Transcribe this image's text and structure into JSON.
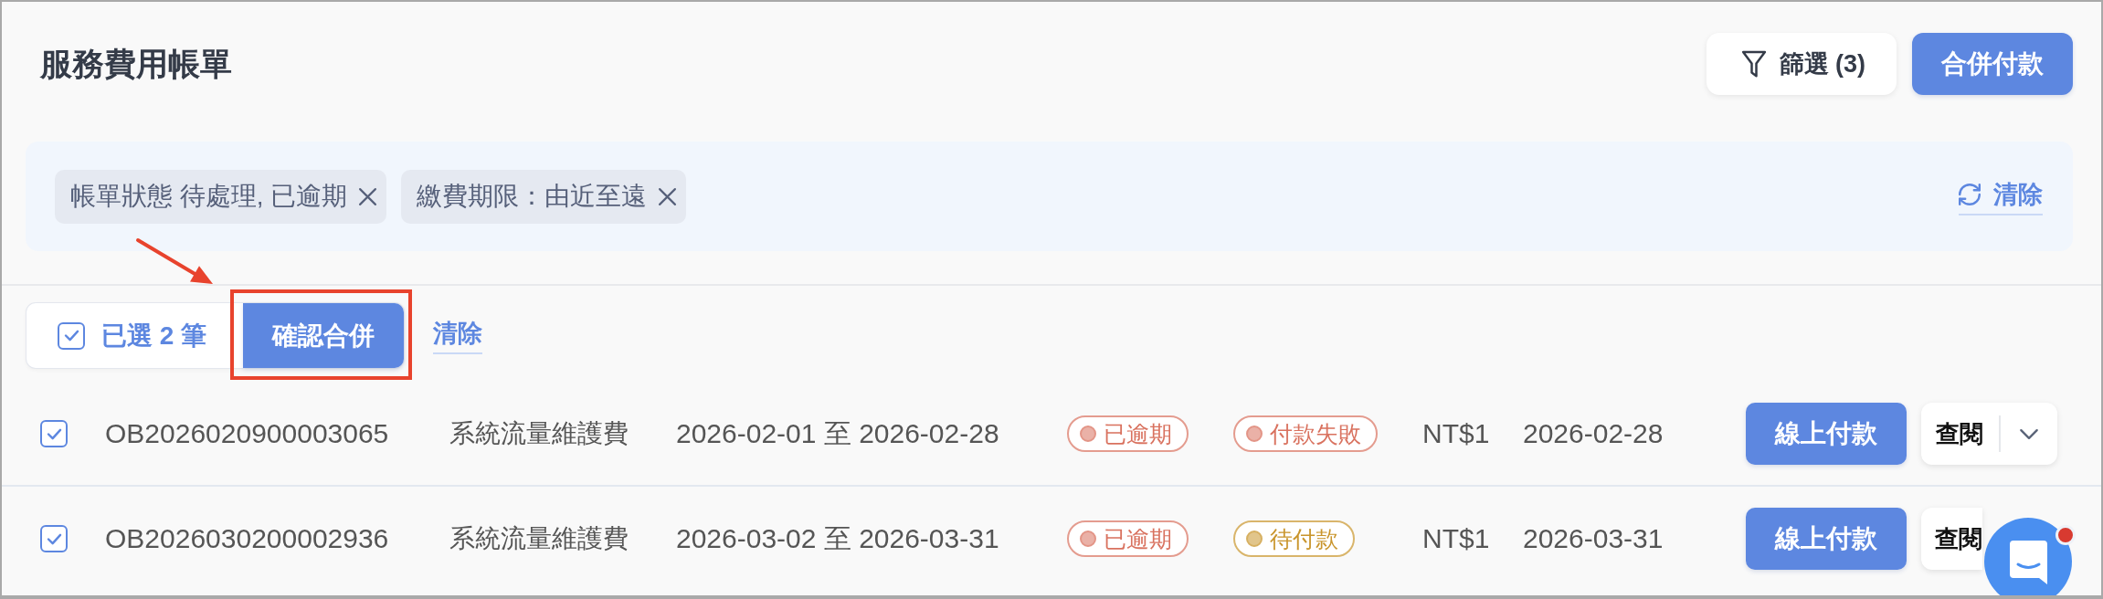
{
  "page": {
    "title": "服務費用帳單"
  },
  "toolbar": {
    "filter_button": "篩選 (3)",
    "merge_button": "合併付款"
  },
  "filter_panel": {
    "chips": [
      {
        "label": "帳單狀態 待處理, 已逾期"
      },
      {
        "label": "繳費期限：由近至遠"
      }
    ],
    "clear_link": "清除"
  },
  "selection_bar": {
    "checked": true,
    "count": "已選 2 筆",
    "confirm_button": {
      "label": "確認合併",
      "highlighted": true
    },
    "clear_link": "清除"
  },
  "rows": [
    {
      "selected": true,
      "number": "OB2026020900003065",
      "item": "系統流量維護費",
      "period": "2026-02-01 至 2026-02-28",
      "badges": [
        {
          "label": "已逾期",
          "color": "#d9725f"
        },
        {
          "label": "付款失敗",
          "color": "#d9725f"
        }
      ],
      "amount": "NT$1",
      "date": "2026-02-28",
      "pay_button": "線上付款",
      "view_button": "查閱"
    },
    {
      "selected": true,
      "number": "OB2026030200002936",
      "item": "系統流量維護費",
      "period": "2026-03-02 至 2026-03-31",
      "badges": [
        {
          "label": "已逾期",
          "color": "#d9725f"
        },
        {
          "label": "待付款",
          "color": "#c9952c"
        }
      ],
      "amount": "NT$1",
      "date": "2026-03-31",
      "pay_button": "線上付款",
      "view_button": "查閱"
    }
  ],
  "chat_launcher": {
    "unread": true
  }
}
